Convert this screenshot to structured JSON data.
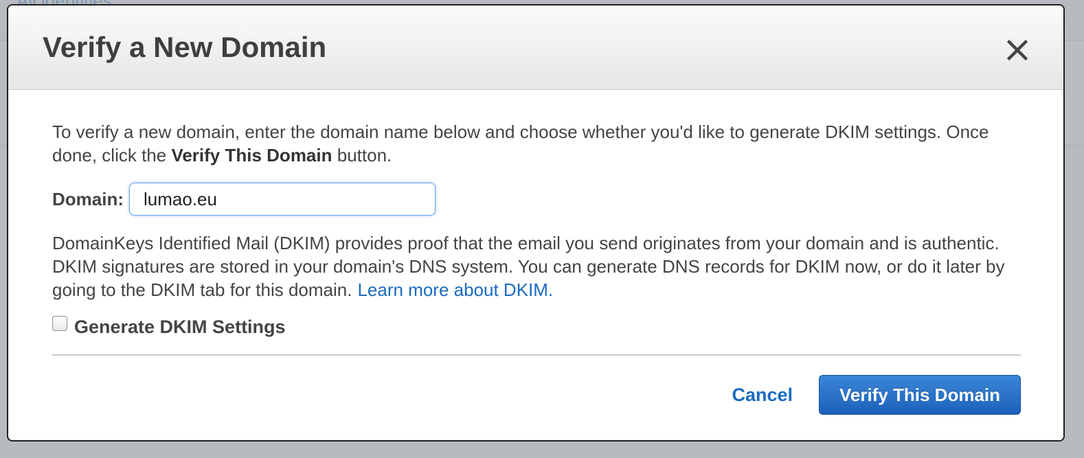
{
  "background": {
    "link_text": "All identities"
  },
  "dialog": {
    "title": "Verify a New Domain",
    "close_icon": "close-icon",
    "intro": {
      "text_before": "To verify a new domain, enter the domain name below and choose whether you'd like to generate DKIM settings. Once done, click the ",
      "bold_text": "Verify This Domain",
      "text_after": " button."
    },
    "domain": {
      "label": "Domain:",
      "value": "lumao.eu",
      "placeholder": ""
    },
    "dkim": {
      "description": "DomainKeys Identified Mail (DKIM) provides proof that the email you send originates from your domain and is authentic. DKIM signatures are stored in your domain's DNS system. You can generate DNS records for DKIM now, or do it later by going to the DKIM tab for this domain.",
      "learn_more_link": "Learn more about DKIM.",
      "checkbox_label": "Generate DKIM Settings",
      "checkbox_checked": false
    },
    "buttons": {
      "cancel_label": "Cancel",
      "verify_label": "Verify This Domain"
    }
  },
  "colors": {
    "link": "#1a6bbf",
    "primary_button": "#2b73c9",
    "overlay": "#a3a7ac"
  }
}
